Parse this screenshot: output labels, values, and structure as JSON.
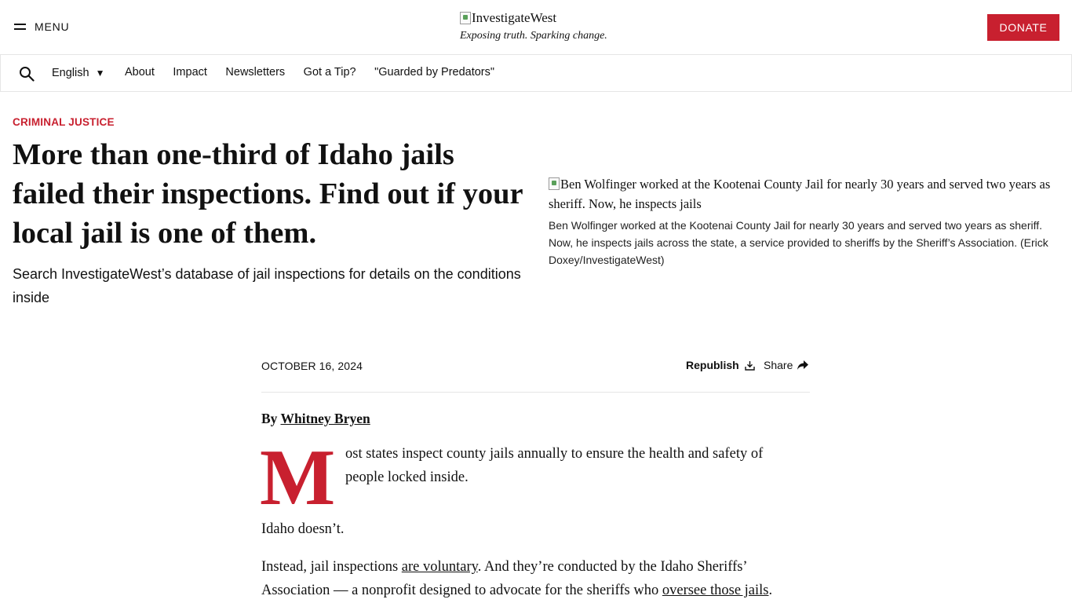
{
  "header": {
    "menu_label": "MENU",
    "logo_alt": "InvestigateWest",
    "tagline": "Exposing truth. Sparking change.",
    "donate_label": "DONATE",
    "accent_color": "#c8202f"
  },
  "nav": {
    "language": "English",
    "links": [
      "About",
      "Impact",
      "Newsletters",
      "Got a Tip?",
      "\"Guarded by Predators\""
    ]
  },
  "article": {
    "category": "CRIMINAL JUSTICE",
    "headline": "More than one-third of Idaho jails failed their inspections. Find out if your local jail is one of them.",
    "dek": "Search InvestigateWest’s database of jail inspections for details on the conditions inside",
    "image_alt": "Ben Wolfinger worked at the Kootenai County Jail for nearly 30 years and served two years as sheriff. Now, he inspects jails",
    "caption": "Ben Wolfinger worked at the Kootenai County Jail for nearly 30 years and served two years as sheriff. Now, he inspects jails across the state, a service provided to sheriffs by the Sheriff’s Association. (Erick Doxey/InvestigateWest)",
    "date": "OCTOBER 16, 2024",
    "republish_label": "Republish",
    "share_label": "Share",
    "byline_prefix": "By",
    "author": "Whitney Bryen",
    "dropcap": "M",
    "para1": "ost states inspect county jails annually to ensure the health and safety of people locked inside.",
    "para2": "Idaho doesn’t.",
    "para3": {
      "t1": "Instead, jail inspections ",
      "link1": "are voluntary",
      "t2": ". And they’re conducted by the Idaho Sheriffs’ Association — a nonprofit designed to advocate for the sheriffs who ",
      "link2": "oversee those jails",
      "t3": "."
    }
  }
}
